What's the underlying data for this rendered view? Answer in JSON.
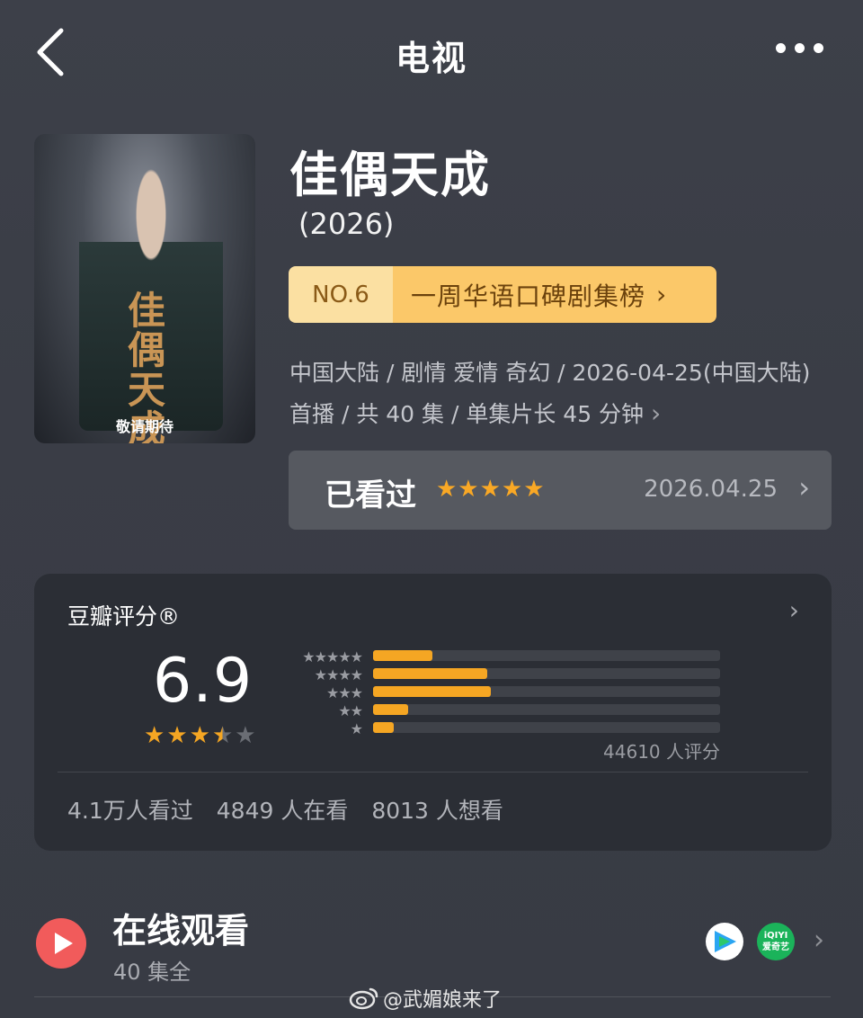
{
  "header": {
    "title": "电视",
    "back_icon": "chevron-left-icon",
    "more_icon": "more-dots-icon"
  },
  "poster": {
    "calligraphy": "佳偶天成",
    "caption": "敬请期待"
  },
  "show": {
    "title": "佳偶天成",
    "year": "(2026)",
    "rank_no": "NO.6",
    "rank_label": "一周华语口碑剧集榜",
    "meta": "中国大陆 / 剧情 爱情 奇幻 / 2026-04-25(中国大陆) 首播 / 共 40 集 / 单集片长 45 分钟"
  },
  "watched": {
    "label": "已看过",
    "stars": 5,
    "date": "2026.04.25"
  },
  "rating": {
    "title": "豆瓣评分®",
    "score": "6.9",
    "stars": 3.5,
    "count": "44610 人评分",
    "distribution": [
      {
        "stars": 5,
        "fraction": 0.17
      },
      {
        "stars": 4,
        "fraction": 0.33
      },
      {
        "stars": 3,
        "fraction": 0.34
      },
      {
        "stars": 2,
        "fraction": 0.1
      },
      {
        "stars": 1,
        "fraction": 0.06
      }
    ],
    "stats": [
      "4.1万人看过",
      "4849 人在看",
      "8013 人想看"
    ]
  },
  "online": {
    "title": "在线观看",
    "subtitle": "40 集全",
    "platforms": [
      {
        "name": "tencent-video"
      },
      {
        "name": "iqiyi",
        "label_top": "iQIYI",
        "label_bottom": "爱奇艺"
      }
    ]
  },
  "watermark": "@武媚娘来了",
  "colors": {
    "accent": "#f5a623",
    "rank_bg": "#fbc869",
    "play_red": "#f15b5b"
  }
}
